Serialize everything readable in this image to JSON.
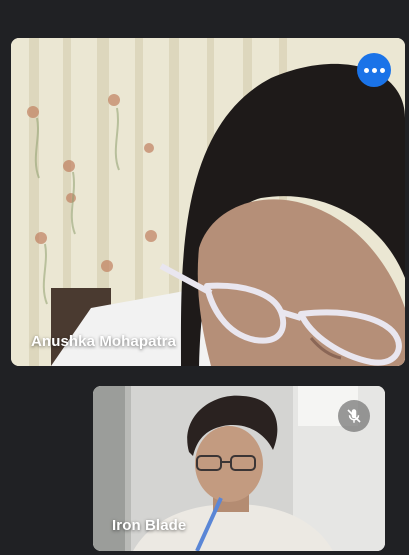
{
  "participants": [
    {
      "name": "Anushka Mohapatra",
      "tile": "main",
      "has_more_options": true
    },
    {
      "name": "Iron Blade",
      "tile": "secondary",
      "muted": true
    }
  ],
  "colors": {
    "background": "#202124",
    "accent": "#1a73e8",
    "label_text": "#ffffff",
    "muted_badge": "#787878"
  },
  "icons": {
    "more_options": "more-horiz-icon",
    "mic_off": "mic-off-icon"
  }
}
